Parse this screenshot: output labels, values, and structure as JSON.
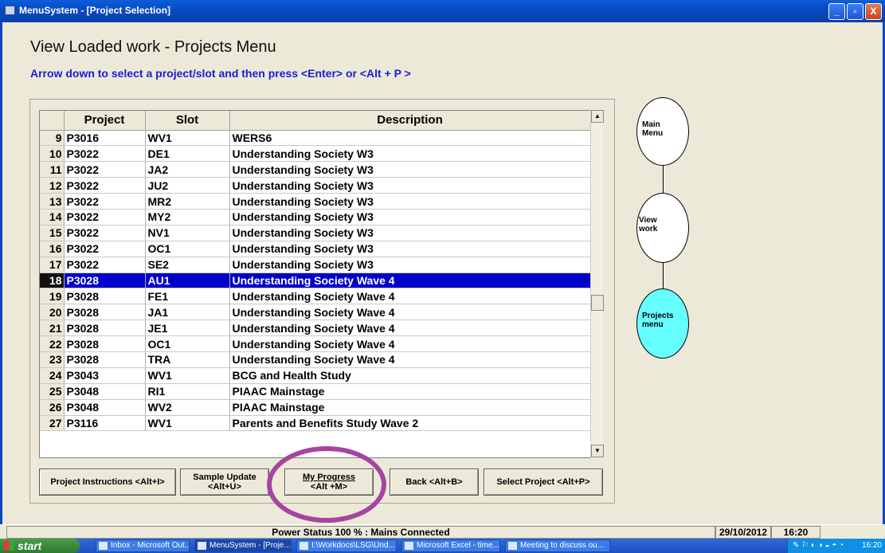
{
  "window": {
    "title": "MenuSystem - [Project Selection]",
    "min_label": "_",
    "max_label": "▫",
    "close_label": "X"
  },
  "page": {
    "heading": "View Loaded work - Projects Menu",
    "subheading": "Arrow down to select a project/slot and then press <Enter> or <Alt + P >"
  },
  "table": {
    "columns": [
      "Project",
      "Slot",
      "Description"
    ],
    "selected_row": "18",
    "rows": [
      {
        "num": "9",
        "project": "P3016",
        "slot": "WV1",
        "description": "WERS6"
      },
      {
        "num": "10",
        "project": "P3022",
        "slot": "DE1",
        "description": "Understanding Society W3"
      },
      {
        "num": "11",
        "project": "P3022",
        "slot": "JA2",
        "description": "Understanding Society W3"
      },
      {
        "num": "12",
        "project": "P3022",
        "slot": "JU2",
        "description": "Understanding Society W3"
      },
      {
        "num": "13",
        "project": "P3022",
        "slot": "MR2",
        "description": "Understanding Society W3"
      },
      {
        "num": "14",
        "project": "P3022",
        "slot": "MY2",
        "description": "Understanding Society W3"
      },
      {
        "num": "15",
        "project": "P3022",
        "slot": "NV1",
        "description": "Understanding Society W3"
      },
      {
        "num": "16",
        "project": "P3022",
        "slot": "OC1",
        "description": "Understanding Society W3"
      },
      {
        "num": "17",
        "project": "P3022",
        "slot": "SE2",
        "description": "Understanding Society W3"
      },
      {
        "num": "18",
        "project": "P3028",
        "slot": "AU1",
        "description": "Understanding Society Wave 4"
      },
      {
        "num": "19",
        "project": "P3028",
        "slot": "FE1",
        "description": "Understanding Society Wave 4"
      },
      {
        "num": "20",
        "project": "P3028",
        "slot": "JA1",
        "description": "Understanding Society Wave 4"
      },
      {
        "num": "21",
        "project": "P3028",
        "slot": "JE1",
        "description": "Understanding Society Wave 4"
      },
      {
        "num": "22",
        "project": "P3028",
        "slot": "OC1",
        "description": "Understanding Society Wave 4"
      },
      {
        "num": "23",
        "project": "P3028",
        "slot": "TRA",
        "description": "Understanding Society Wave 4"
      },
      {
        "num": "24",
        "project": "P3043",
        "slot": "WV1",
        "description": "BCG and Health Study"
      },
      {
        "num": "25",
        "project": "P3048",
        "slot": "RI1",
        "description": "PIAAC Mainstage"
      },
      {
        "num": "26",
        "project": "P3048",
        "slot": "WV2",
        "description": "PIAAC Mainstage"
      },
      {
        "num": "27",
        "project": "P3116",
        "slot": "WV1",
        "description": "Parents and Benefits Study Wave 2"
      }
    ]
  },
  "buttons": {
    "instructions": "Project Instructions <Alt+I>",
    "sample_update_1": "Sample Update",
    "sample_update_2": "<Alt+U>",
    "my_progress_1": "My Progress",
    "my_progress_2": "<Alt +M>",
    "back": "Back <Alt+B>",
    "select_project": "Select Project <Alt+P>"
  },
  "nav_nodes": {
    "main_1": "Main",
    "main_2": "Menu",
    "view_1": "View",
    "view_2": "work",
    "projects_1": "Projects",
    "projects_2": "menu",
    "active_color": "#66ffff"
  },
  "status": {
    "power": "Power Status 100 % : Mains Connected",
    "date": "29/10/2012",
    "time": "16:20"
  },
  "taskbar": {
    "start": "start",
    "tasks": [
      "Inbox - Microsoft Out...",
      "MenuSystem - [Proje...",
      "I:\\Workdocs\\LSG\\Und...",
      "Microsoft Excel - time...",
      "Meeting to discuss ou..."
    ],
    "clock": "16:20"
  },
  "annotation_color": "#a545a0"
}
